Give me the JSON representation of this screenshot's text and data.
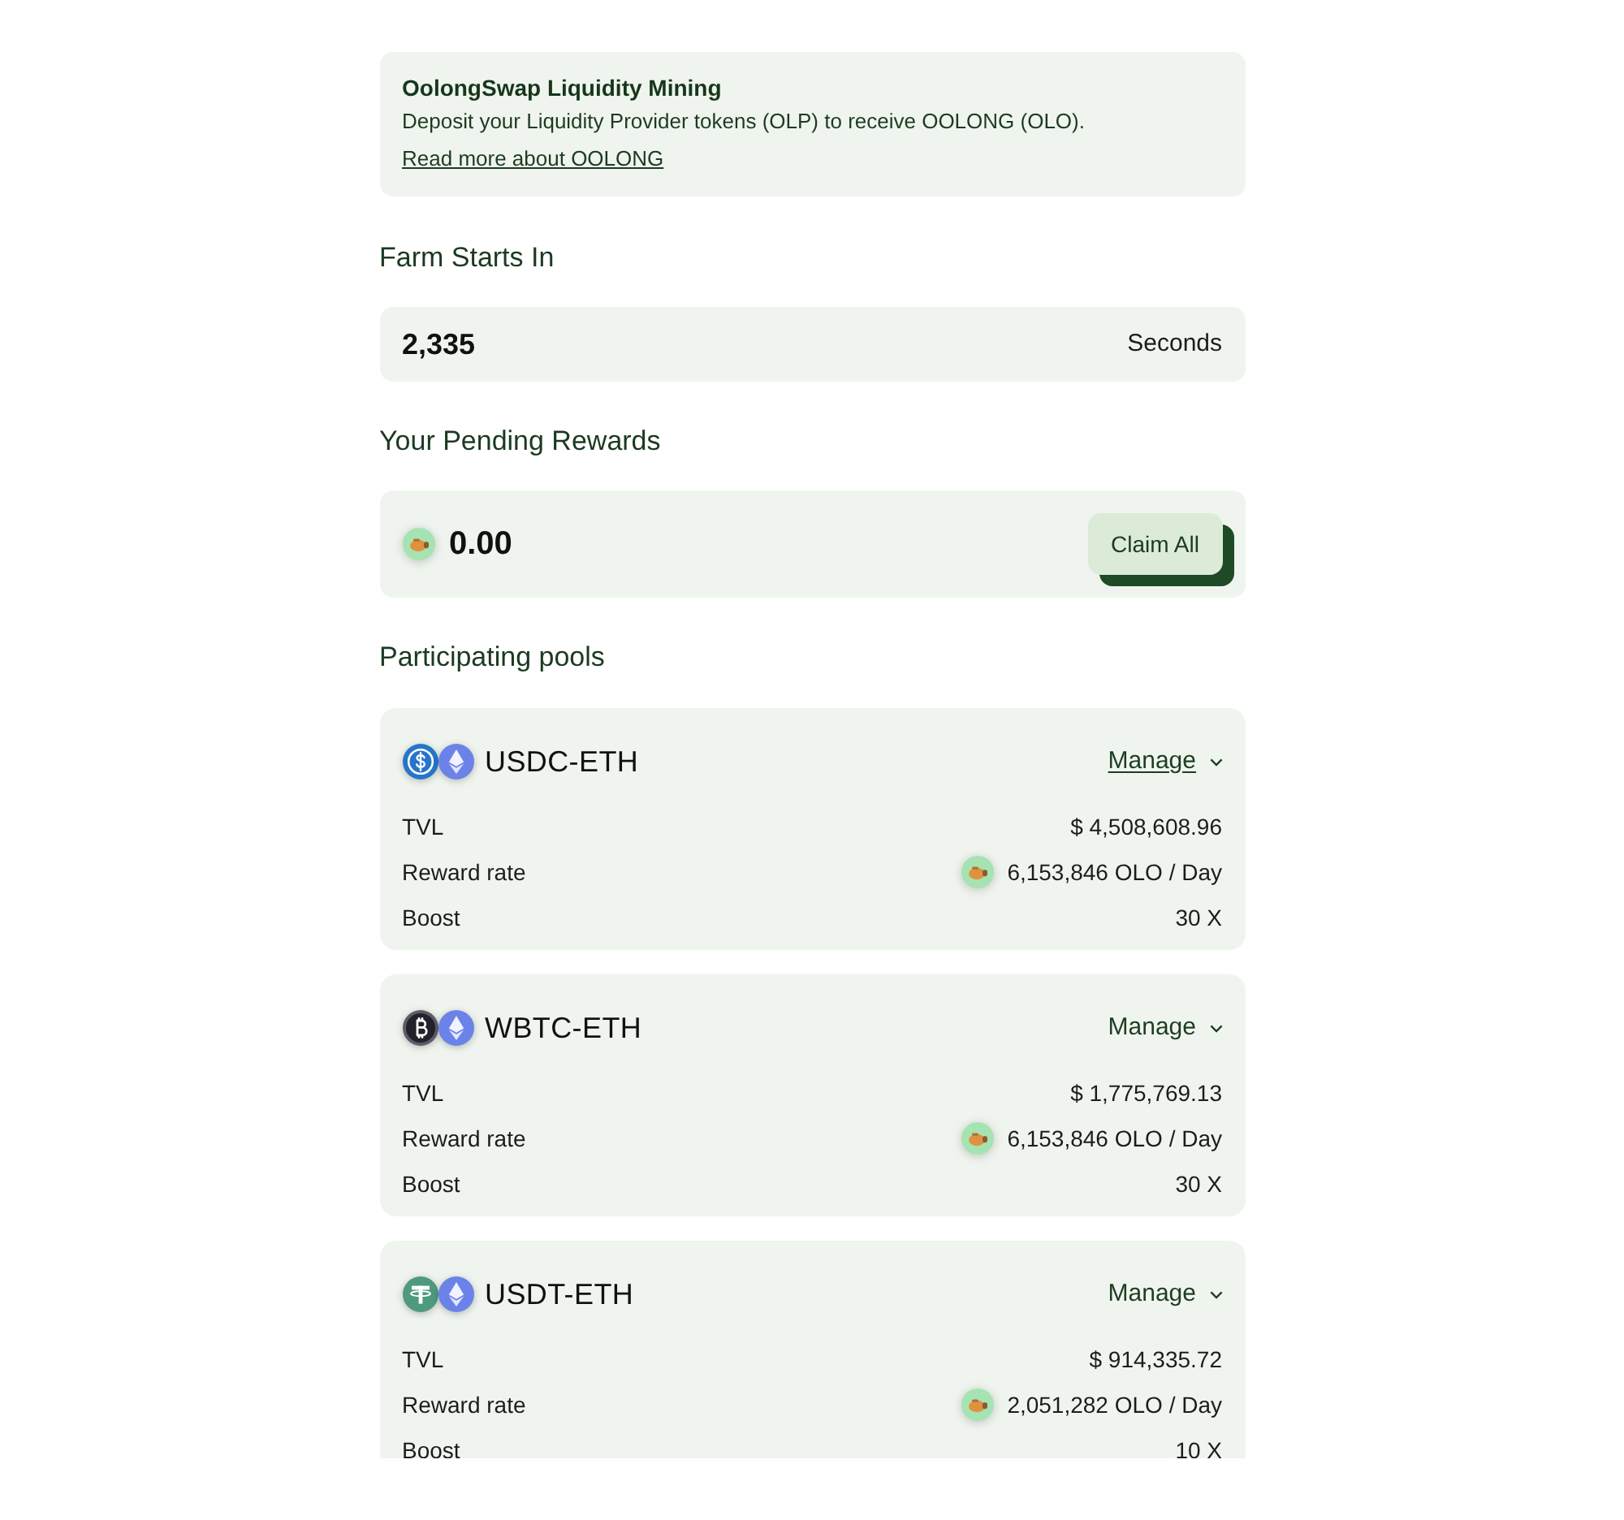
{
  "info": {
    "title": "OolongSwap Liquidity Mining",
    "text": "Deposit your Liquidity Provider tokens (OLP) to receive OOLONG (OLO).",
    "link": "Read more about OOLONG"
  },
  "countdown": {
    "heading": "Farm Starts In",
    "value": "2,335",
    "unit": "Seconds"
  },
  "rewards": {
    "heading": "Your Pending Rewards",
    "amount": "0.00",
    "button": "Claim All"
  },
  "pools": {
    "heading": "Participating pools",
    "items": [
      {
        "name": "USDC-ETH",
        "tokens": [
          {
            "kind": "dollar"
          },
          {
            "kind": "diamond"
          }
        ],
        "manage": {
          "label": "Manage",
          "hovered": true
        },
        "stats": [
          {
            "kind": "plain",
            "label": "TVL",
            "value": "$ 4,508,608.96"
          },
          {
            "kind": "reward",
            "label": "Reward rate",
            "value": "6,153,846 OLO / Day"
          },
          {
            "kind": "plain",
            "label": "Boost",
            "value": "30 X"
          }
        ]
      },
      {
        "name": "WBTC-ETH",
        "tokens": [
          {
            "kind": "bitcoin"
          },
          {
            "kind": "diamond"
          }
        ],
        "manage": {
          "label": "Manage",
          "hovered": false
        },
        "stats": [
          {
            "kind": "plain",
            "label": "TVL",
            "value": "$ 1,775,769.13"
          },
          {
            "kind": "reward",
            "label": "Reward rate",
            "value": "6,153,846 OLO / Day"
          },
          {
            "kind": "plain",
            "label": "Boost",
            "value": "30 X"
          }
        ]
      },
      {
        "name": "USDT-ETH",
        "tokens": [
          {
            "kind": "tether"
          },
          {
            "kind": "diamond"
          }
        ],
        "manage": {
          "label": "Manage",
          "hovered": false
        },
        "stats": [
          {
            "kind": "plain",
            "label": "TVL",
            "value": "$ 914,335.72"
          },
          {
            "kind": "reward",
            "label": "Reward rate",
            "value": "2,051,282 OLO / Day"
          },
          {
            "kind": "plain",
            "label": "Boost",
            "value": "10 X"
          }
        ]
      }
    ]
  }
}
